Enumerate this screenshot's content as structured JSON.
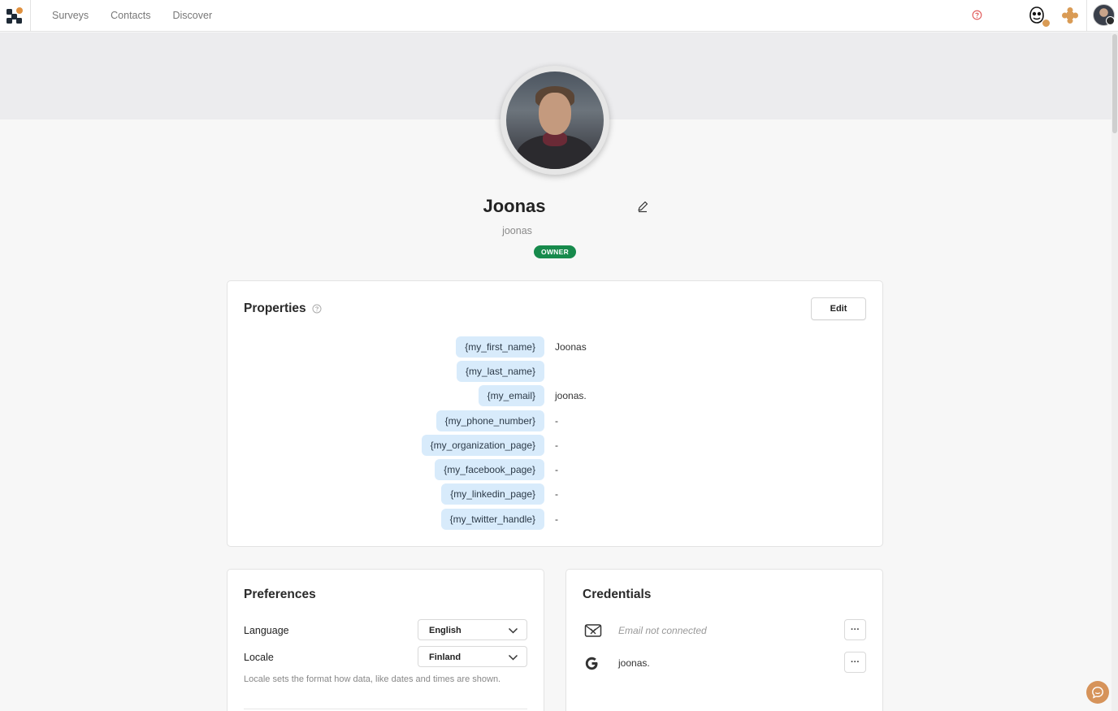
{
  "nav": {
    "items": [
      "Surveys",
      "Contacts",
      "Discover"
    ]
  },
  "icons": {
    "logo": "app-logo-icon",
    "help": "help-circle-icon",
    "mascot": "mascot-icon",
    "puzzle": "puzzle-icon",
    "edit_name": "edit-pencil-icon",
    "email": "mail-icon",
    "google": "google-icon",
    "chat": "chat-icon"
  },
  "colors": {
    "owner_badge": "#178a4c",
    "tag_bg": "#d8ebfb",
    "accent": "#d6935a"
  },
  "profile": {
    "name": "Joonas",
    "username": "joonas",
    "role_badge": "OWNER"
  },
  "properties": {
    "title": "Properties",
    "edit_label": "Edit",
    "rows": [
      {
        "tag": "{my_first_name}",
        "value": "Joonas"
      },
      {
        "tag": "{my_last_name}",
        "value": ""
      },
      {
        "tag": "{my_email}",
        "value": "joonas."
      },
      {
        "tag": "{my_phone_number}",
        "value": "-"
      },
      {
        "tag": "{my_organization_page}",
        "value": "-"
      },
      {
        "tag": "{my_facebook_page}",
        "value": "-"
      },
      {
        "tag": "{my_linkedin_page}",
        "value": "-"
      },
      {
        "tag": "{my_twitter_handle}",
        "value": "-"
      }
    ]
  },
  "preferences": {
    "title": "Preferences",
    "language_label": "Language",
    "language_value": "English",
    "locale_label": "Locale",
    "locale_value": "Finland",
    "locale_note": "Locale sets the format how data, like dates and times are shown."
  },
  "credentials": {
    "title": "Credentials",
    "email_status": "Email not connected",
    "google_account": "joonas.",
    "more_label": "···"
  }
}
